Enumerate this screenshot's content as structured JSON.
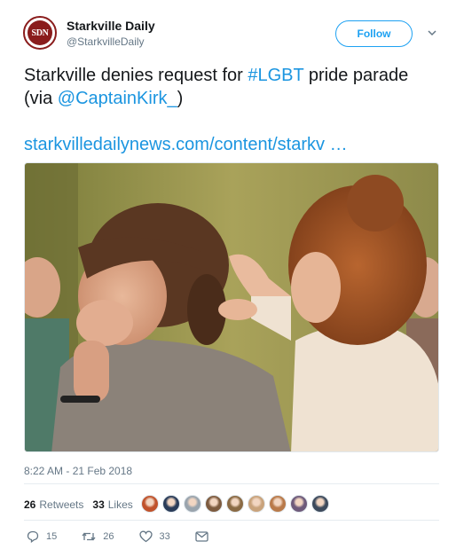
{
  "author": {
    "avatar_text": "SDN",
    "name": "Starkville Daily",
    "handle": "@StarkvilleDaily"
  },
  "follow_label": "Follow",
  "tweet": {
    "text_before": "Starkville denies request for ",
    "hashtag": "#LGBT",
    "text_middle": " pride parade (via ",
    "mention": "@CaptainKirk_",
    "text_after": ")",
    "url": "starkvilledailynews.com/content/starkv …"
  },
  "timestamp": "8:22 AM - 21 Feb 2018",
  "stats": {
    "retweets_count": "26",
    "retweets_label": "Retweets",
    "likes_count": "33",
    "likes_label": "Likes"
  },
  "likers": [
    "#c0522b",
    "#2a3c59",
    "#9aa4ad",
    "#7d5b3f",
    "#8a6a44",
    "#c9a37c",
    "#b97a4a",
    "#6e5a7a",
    "#3d4a5c"
  ],
  "actions": {
    "reply_count": "15",
    "retweet_count": "26",
    "like_count": "33"
  },
  "colors": {
    "accent": "#1da1f2",
    "link": "#1b95e0",
    "muted": "#657786"
  }
}
